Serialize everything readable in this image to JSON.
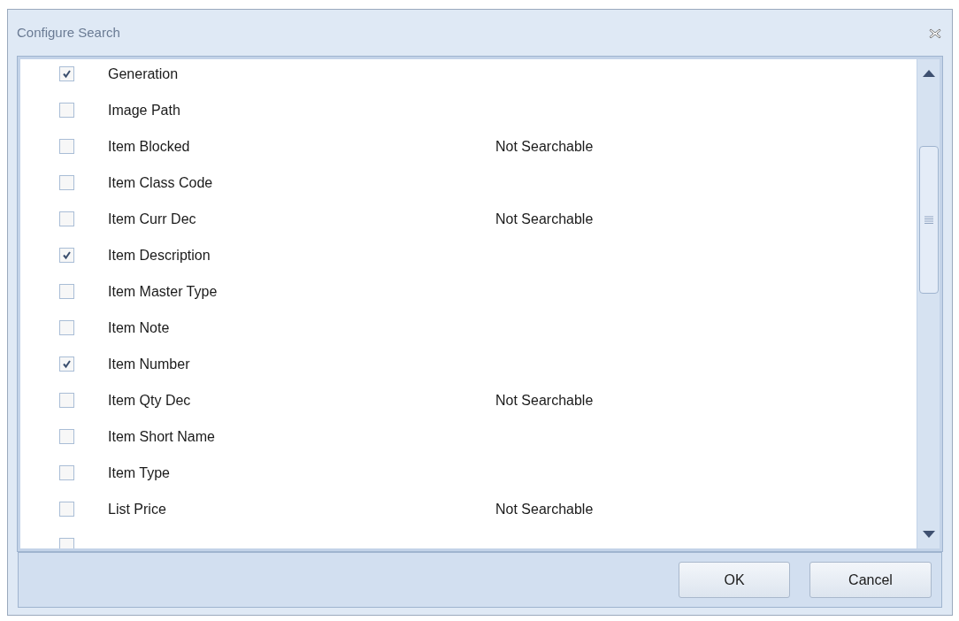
{
  "window": {
    "title": "Configure Search"
  },
  "fields": [
    {
      "label": "Generation",
      "checked": true
    },
    {
      "label": "Image Path",
      "checked": false
    },
    {
      "label": "Item Blocked",
      "checked": false,
      "note": "Not Searchable"
    },
    {
      "label": "Item Class Code",
      "checked": false
    },
    {
      "label": "Item Curr Dec",
      "checked": false,
      "note": "Not Searchable"
    },
    {
      "label": "Item Description",
      "checked": true
    },
    {
      "label": "Item Master Type",
      "checked": false
    },
    {
      "label": "Item Note",
      "checked": false
    },
    {
      "label": "Item Number",
      "checked": true
    },
    {
      "label": "Item Qty Dec",
      "checked": false,
      "note": "Not Searchable"
    },
    {
      "label": "Item Short Name",
      "checked": false
    },
    {
      "label": "Item Type",
      "checked": false
    },
    {
      "label": "List Price",
      "checked": false,
      "note": "Not Searchable"
    },
    {
      "checked": false
    }
  ],
  "buttons": [
    "OK",
    "Cancel"
  ]
}
